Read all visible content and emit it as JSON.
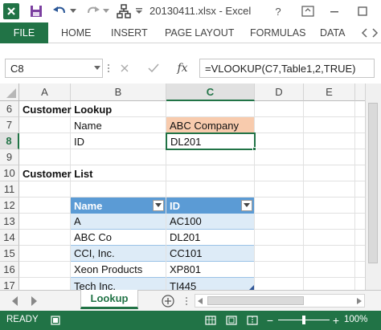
{
  "window": {
    "title": "20130411.xlsx - Excel",
    "help": "?"
  },
  "ribbon": {
    "tabs": [
      "FILE",
      "HOME",
      "INSERT",
      "PAGE LAYOUT",
      "FORMULAS",
      "DATA"
    ]
  },
  "formula_bar": {
    "name_box": "C8",
    "fx": "fx",
    "formula": "=VLOOKUP(C7,Table1,2,TRUE)"
  },
  "grid": {
    "columns": [
      "A",
      "B",
      "C",
      "D",
      "E"
    ],
    "active_column": "C",
    "active_row": "8",
    "rows": [
      "6",
      "7",
      "8",
      "9",
      "10",
      "11",
      "12",
      "13",
      "14",
      "15",
      "16",
      "17"
    ],
    "lookup_title": "Customer Lookup",
    "lookup_name_label": "Name",
    "lookup_name_value": "ABC Company",
    "lookup_id_label": "ID",
    "lookup_id_value": "DL201",
    "list_title": "Customer List",
    "table_headers": [
      "Name",
      "ID"
    ],
    "table_rows": [
      [
        "A",
        "AC100"
      ],
      [
        "ABC Co",
        "DL201"
      ],
      [
        "CCI, Inc.",
        "CC101"
      ],
      [
        "Xeon Products",
        "XP801"
      ],
      [
        "Tech Inc.",
        "TI445"
      ]
    ]
  },
  "sheets": {
    "active": "Lookup"
  },
  "status": {
    "ready": "READY",
    "zoom": "100%"
  },
  "colors": {
    "excel_green": "#217346",
    "table_header": "#5b9bd5",
    "table_band": "#ddebf7",
    "name_highlight": "#f8cbad"
  }
}
